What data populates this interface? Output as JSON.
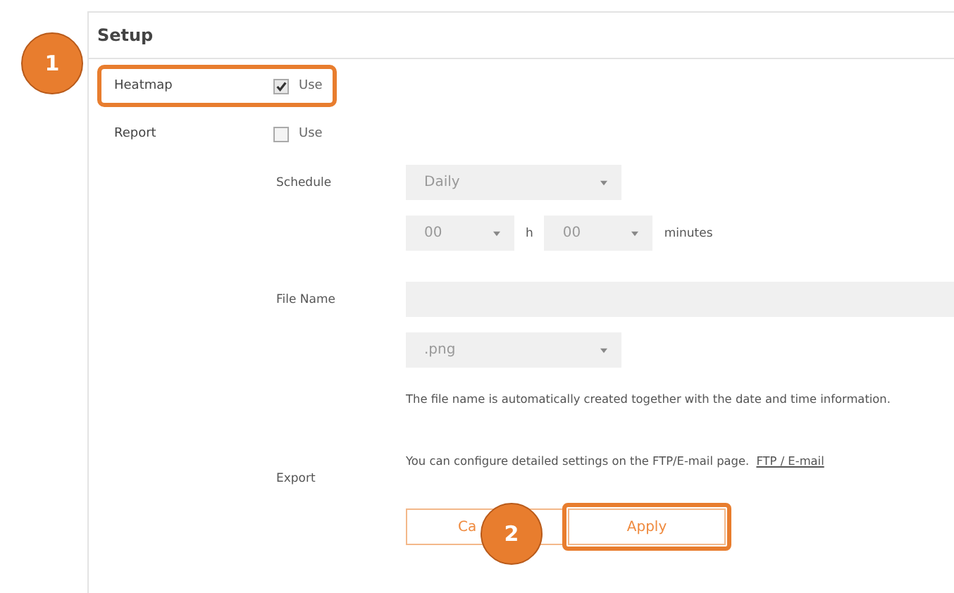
{
  "panel": {
    "title": "Setup"
  },
  "toggles": [
    {
      "label": "Heatmap",
      "option": "Use",
      "checked": true,
      "highlighted": true
    },
    {
      "label": "Report",
      "option": "Use",
      "checked": false,
      "highlighted": false
    }
  ],
  "schedule": {
    "label": "Schedule",
    "frequency": "Daily",
    "hour": "00",
    "hour_unit": "h",
    "minute": "00",
    "minute_unit": "minutes"
  },
  "file_name": {
    "label": "File Name",
    "format": ".png",
    "note": "The file name is automatically created together with the date and time information."
  },
  "export": {
    "label": "Export",
    "text": "You can configure detailed settings on the FTP/E-mail page.",
    "link": "FTP / E-mail"
  },
  "buttons": [
    {
      "label": "Ca",
      "highlighted": false
    },
    {
      "label": "Apply",
      "highlighted": true
    }
  ],
  "callouts": [
    {
      "number": "1",
      "kind": "heatmap"
    },
    {
      "number": "2",
      "kind": "apply"
    }
  ]
}
